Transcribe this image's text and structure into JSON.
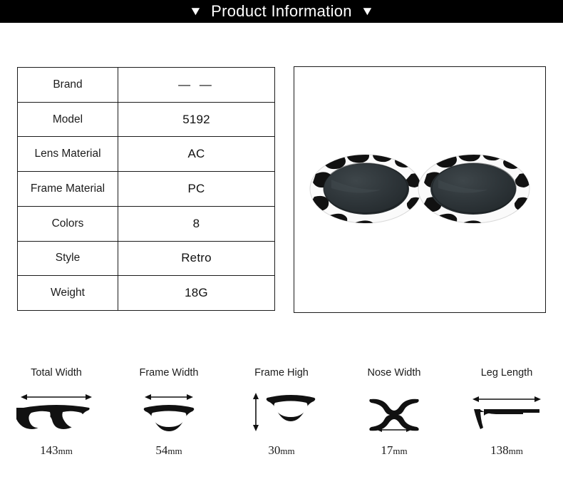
{
  "header": {
    "left_icon": "triangle-down-icon",
    "title": "Product Information",
    "right_icon": "triangle-down-icon",
    "glyph": "▼",
    "background": "#000000",
    "text_color": "#ffffff"
  },
  "spec_table": {
    "rows": [
      {
        "label": "Brand",
        "value": "— —"
      },
      {
        "label": "Model",
        "value": "5192"
      },
      {
        "label": "Lens Material",
        "value": "AC"
      },
      {
        "label": "Frame Material",
        "value": "PC"
      },
      {
        "label": "Colors",
        "value": "8"
      },
      {
        "label": "Style",
        "value": "Retro"
      },
      {
        "label": "Weight",
        "value": "18G"
      }
    ]
  },
  "product_image": {
    "alt": "Oval retro sunglasses with white cow-print spotted frame and dark smoke lenses",
    "frame_color": "#ffffff",
    "spot_color": "#111111",
    "lens_color": "#2f3639"
  },
  "measurements": [
    {
      "title": "Total Width",
      "value": "143",
      "unit": "mm",
      "icon": "full-frame-width-icon"
    },
    {
      "title": "Frame Width",
      "value": "54",
      "unit": "mm",
      "icon": "single-lens-width-icon"
    },
    {
      "title": "Frame High",
      "value": "30",
      "unit": "mm",
      "icon": "single-lens-height-icon"
    },
    {
      "title": "Nose Width",
      "value": "17",
      "unit": "mm",
      "icon": "nose-bridge-icon"
    },
    {
      "title": "Leg Length",
      "value": "138",
      "unit": "mm",
      "icon": "temple-arm-icon"
    }
  ]
}
